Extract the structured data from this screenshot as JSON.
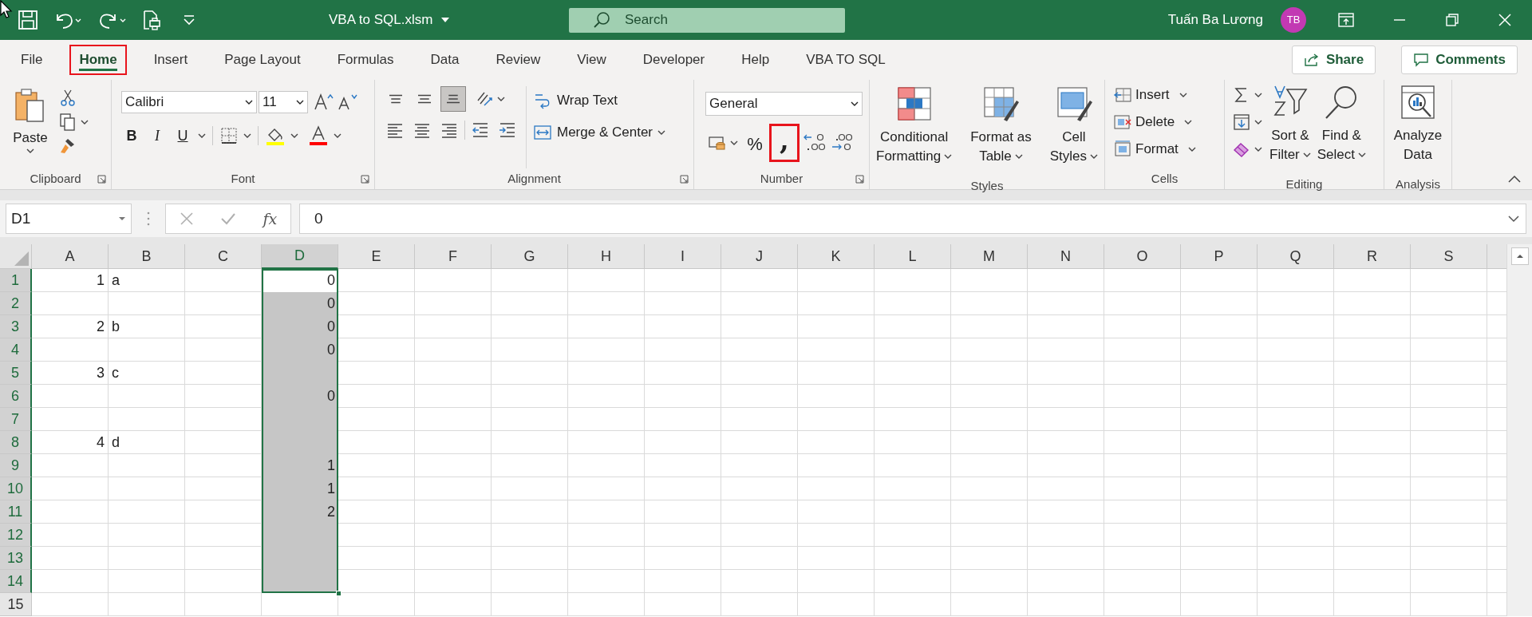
{
  "title_bar": {
    "file_name": "VBA to SQL.xlsm",
    "search_placeholder": "Search",
    "user_name": "Tuấn Ba Lương",
    "avatar_initials": "TB"
  },
  "tabs": [
    {
      "label": "File",
      "selected": false,
      "highlighted": false
    },
    {
      "label": "Home",
      "selected": true,
      "highlighted": true
    },
    {
      "label": "Insert",
      "selected": false,
      "highlighted": false
    },
    {
      "label": "Page Layout",
      "selected": false,
      "highlighted": false
    },
    {
      "label": "Formulas",
      "selected": false,
      "highlighted": false
    },
    {
      "label": "Data",
      "selected": false,
      "highlighted": false
    },
    {
      "label": "Review",
      "selected": false,
      "highlighted": false
    },
    {
      "label": "View",
      "selected": false,
      "highlighted": false
    },
    {
      "label": "Developer",
      "selected": false,
      "highlighted": false
    },
    {
      "label": "Help",
      "selected": false,
      "highlighted": false
    },
    {
      "label": "VBA TO SQL",
      "selected": false,
      "highlighted": false
    }
  ],
  "share_button": "Share",
  "comments_button": "Comments",
  "ribbon": {
    "clipboard": {
      "paste": "Paste",
      "group_label": "Clipboard"
    },
    "font": {
      "font_name": "Calibri",
      "font_size": "11",
      "bold": "B",
      "italic": "I",
      "underline": "U",
      "group_label": "Font"
    },
    "alignment": {
      "vertical_align": [
        {
          "selected": false
        },
        {
          "selected": false
        },
        {
          "selected": true
        }
      ],
      "wrap_text": "Wrap Text",
      "merge_center": "Merge & Center",
      "group_label": "Alignment"
    },
    "number": {
      "format": "General",
      "percent": "%",
      "comma_style": ",",
      "comma_highlighted": true,
      "group_label": "Number"
    },
    "styles": {
      "buttons": [
        {
          "kind": "conditional",
          "label_lines": [
            "Conditional",
            "Formatting"
          ],
          "dropdown": true
        },
        {
          "kind": "table",
          "label_lines": [
            "Format as",
            "Table"
          ],
          "dropdown": true
        },
        {
          "kind": "cellstyles",
          "label_lines": [
            "Cell",
            "Styles"
          ],
          "dropdown": true
        }
      ],
      "group_label": "Styles"
    },
    "cells": {
      "buttons": [
        {
          "kind": "insert",
          "label": "Insert"
        },
        {
          "kind": "delete",
          "label": "Delete"
        },
        {
          "kind": "format",
          "label": "Format"
        }
      ],
      "group_label": "Cells"
    },
    "editing": {
      "buttons": [
        {
          "kind": "sort",
          "label_lines": [
            "Sort &",
            "Filter"
          ],
          "dropdown": true
        },
        {
          "kind": "find",
          "label_lines": [
            "Find &",
            "Select"
          ],
          "dropdown": true
        }
      ],
      "group_label": "Editing"
    },
    "analysis": {
      "buttons": [
        {
          "kind": "analyze",
          "label_lines": [
            "Analyze",
            "Data"
          ],
          "dropdown": false
        }
      ],
      "group_label": "Analysis"
    }
  },
  "formula_bar": {
    "name_box": "D1",
    "fx": "fx",
    "formula": "0"
  },
  "sheet": {
    "columns": [
      {
        "label": "A",
        "selected": false
      },
      {
        "label": "B",
        "selected": false
      },
      {
        "label": "C",
        "selected": false
      },
      {
        "label": "D",
        "selected": true
      },
      {
        "label": "E",
        "selected": false
      },
      {
        "label": "F",
        "selected": false
      },
      {
        "label": "G",
        "selected": false
      },
      {
        "label": "H",
        "selected": false
      },
      {
        "label": "I",
        "selected": false
      },
      {
        "label": "J",
        "selected": false
      },
      {
        "label": "K",
        "selected": false
      },
      {
        "label": "L",
        "selected": false
      },
      {
        "label": "M",
        "selected": false
      },
      {
        "label": "N",
        "selected": false
      },
      {
        "label": "O",
        "selected": false
      },
      {
        "label": "P",
        "selected": false
      },
      {
        "label": "Q",
        "selected": false
      },
      {
        "label": "R",
        "selected": false
      },
      {
        "label": "S",
        "selected": false
      }
    ],
    "rows": [
      {
        "label": "1",
        "selected": true,
        "active": true,
        "a": "1",
        "b": "a",
        "d": "0"
      },
      {
        "label": "2",
        "selected": true,
        "active": false,
        "d": "0"
      },
      {
        "label": "3",
        "selected": true,
        "active": false,
        "a": "2",
        "b": "b",
        "d": "0"
      },
      {
        "label": "4",
        "selected": true,
        "active": false,
        "d": "0"
      },
      {
        "label": "5",
        "selected": true,
        "active": false,
        "a": "3",
        "b": "c"
      },
      {
        "label": "6",
        "selected": true,
        "active": false,
        "d": "0"
      },
      {
        "label": "7",
        "selected": true,
        "active": false
      },
      {
        "label": "8",
        "selected": true,
        "active": false,
        "a": "4",
        "b": "d"
      },
      {
        "label": "9",
        "selected": true,
        "active": false,
        "d": "1"
      },
      {
        "label": "10",
        "selected": true,
        "active": false,
        "d": "1"
      },
      {
        "label": "11",
        "selected": true,
        "active": false,
        "d": "2"
      },
      {
        "label": "12",
        "selected": true,
        "active": false
      },
      {
        "label": "13",
        "selected": true,
        "active": false
      },
      {
        "label": "14",
        "selected": true,
        "active": false
      },
      {
        "label": "15",
        "selected": false,
        "active": false
      }
    ]
  }
}
